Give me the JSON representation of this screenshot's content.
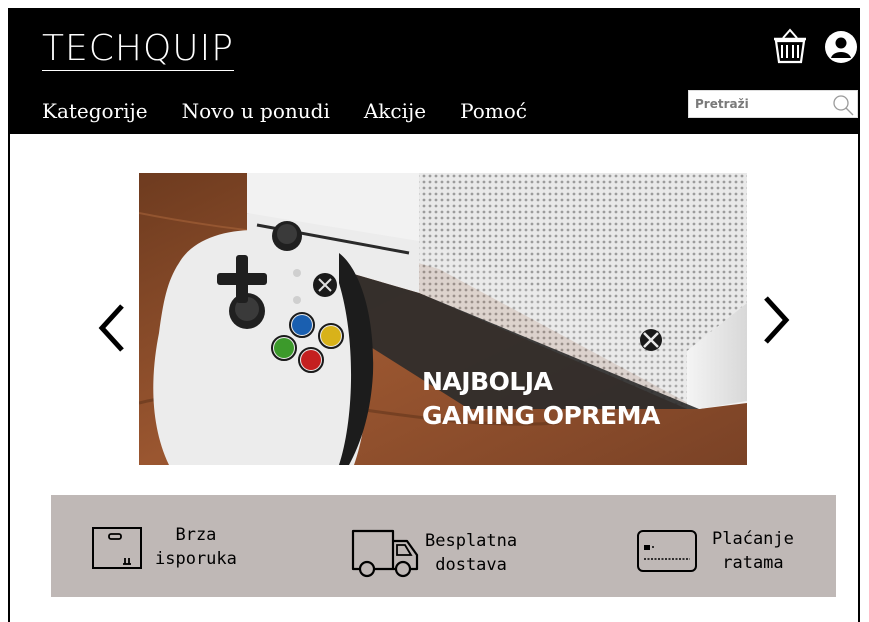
{
  "header": {
    "logo": "TECHQUIP",
    "nav": [
      {
        "label": "Kategorije"
      },
      {
        "label": "Novo u ponudi"
      },
      {
        "label": "Akcije"
      },
      {
        "label": "Pomoć"
      }
    ],
    "search": {
      "placeholder": "Pretraži",
      "value": ""
    },
    "icons": {
      "cart": "basket-icon",
      "user": "user-account-icon"
    }
  },
  "hero": {
    "line1": "NAJBOLJA",
    "line2": "GAMING OPREMA",
    "prev_icon": "chevron-left-icon",
    "next_icon": "chevron-right-icon"
  },
  "features": [
    {
      "line1": "Brza",
      "line2": "isporuka",
      "icon": "package-box-icon"
    },
    {
      "line1": "Besplatna",
      "line2": "dostava",
      "icon": "delivery-truck-icon"
    },
    {
      "line1": "Plaćanje",
      "line2": "ratama",
      "icon": "credit-card-icon"
    }
  ],
  "colors": {
    "header_bg": "#000000",
    "feature_bar_bg": "#bfb8b6",
    "hero_wood": "#8a4d2c"
  }
}
